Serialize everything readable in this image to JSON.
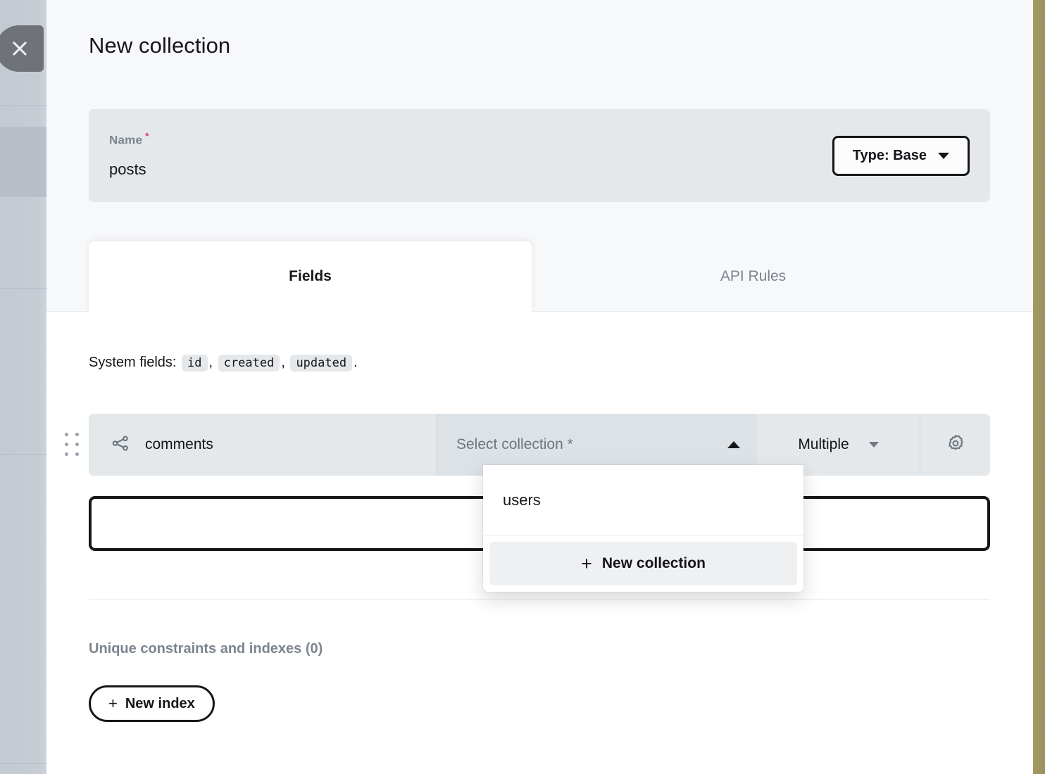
{
  "backdrop": {
    "close_button_icon": "close-icon",
    "accent_strip_color": "#9e9460"
  },
  "header": {
    "title": "New collection",
    "name_field": {
      "label": "Name",
      "required_marker": "*",
      "value": "posts"
    },
    "type_button": {
      "label": "Type: Base",
      "caret_icon": "chevron-down-icon"
    }
  },
  "tabs": [
    {
      "label": "Fields",
      "active": true
    },
    {
      "label": "API Rules",
      "active": false
    }
  ],
  "body": {
    "system_fields": {
      "prefix": "System fields:",
      "fields": [
        "id",
        "created",
        "updated"
      ],
      "separator": ",",
      "terminator": "."
    },
    "field_row": {
      "type_icon": "relation-icon",
      "name": "comments",
      "collection_select": {
        "placeholder": "Select collection *",
        "caret_icon": "chevron-up-icon"
      },
      "cardinality": {
        "label": "Multiple",
        "caret_icon": "chevron-down-icon"
      },
      "options_icon": "gear-icon",
      "drag_handle_icon": "drag-dots-icon"
    },
    "new_field_bar": {
      "label": ""
    },
    "indexes": {
      "title": "Unique constraints and indexes (0)",
      "new_index_button": {
        "plus": "+",
        "label": "New index"
      }
    }
  },
  "dropdown": {
    "options": [
      {
        "label": "users"
      }
    ],
    "action": {
      "plus": "+",
      "label": "New collection"
    }
  }
}
